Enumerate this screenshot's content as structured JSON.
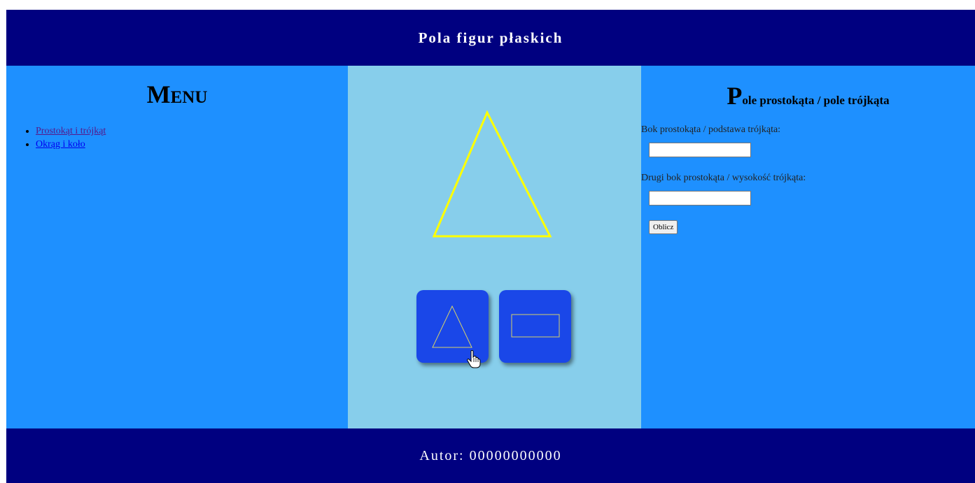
{
  "header": {
    "title": "Pola figur płaskich"
  },
  "menu": {
    "title": "Menu",
    "items": [
      {
        "label": "Prostokąt i trójkąt",
        "visited": true
      },
      {
        "label": "Okrąg i koło",
        "visited": false
      }
    ]
  },
  "canvas": {
    "stroke_color": "#ffff00",
    "selected_shape": "triangle"
  },
  "shape_buttons": [
    {
      "icon": "triangle-icon"
    },
    {
      "icon": "rectangle-icon"
    }
  ],
  "form": {
    "title_first": "P",
    "title_rest": "ole prostokąta / pole trójkąta",
    "field1_label": "Bok prostokąta / podstawa trójkąta:",
    "field1_value": "",
    "field2_label": "Drugi bok prostokąta / wysokość trójkąta:",
    "field2_value": "",
    "button_label": "Oblicz"
  },
  "footer": {
    "text": "Autor: 00000000000"
  },
  "colors": {
    "header_bg": "#000080",
    "side_bg": "#1e90ff",
    "center_bg": "#87ceeb",
    "button_bg": "#1a47e8",
    "shape_stroke": "#ffff00"
  }
}
